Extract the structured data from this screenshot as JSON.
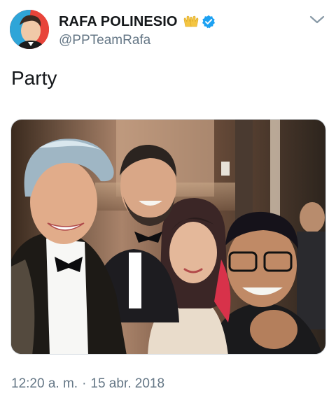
{
  "tweet": {
    "author": {
      "display_name": "RAFA POLINESIO",
      "handle": "@PPTeamRafa",
      "name_emoji": "hands-emoji-icon",
      "verified": true
    },
    "text": "Party",
    "time": "12:20 a. m.",
    "separator": "·",
    "date": "15 abr. 2018"
  },
  "colors": {
    "verified_blue": "#1da1f2",
    "secondary_text": "#657786",
    "primary_text": "#14171a",
    "hands_yellow": "#f4c542"
  },
  "icons": {
    "menu": "chevron-down-icon",
    "verified": "verified-badge-icon"
  }
}
